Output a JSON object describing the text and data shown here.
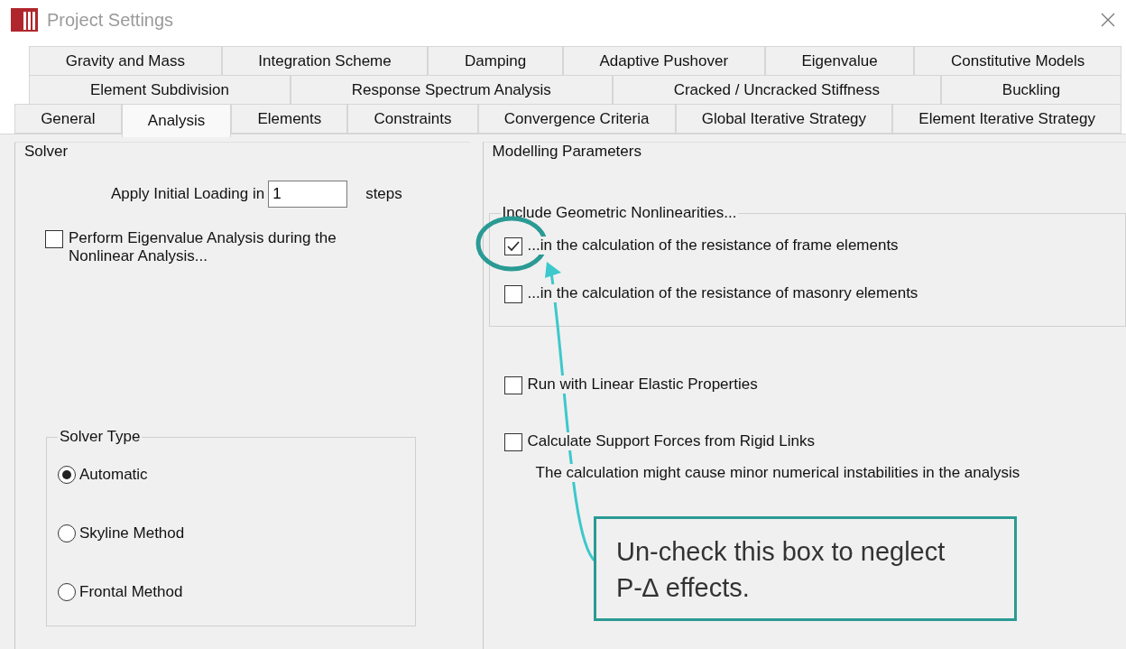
{
  "window": {
    "title": "Project Settings"
  },
  "tab_rows": [
    [
      {
        "label": "Gravity and Mass",
        "selected": false
      },
      {
        "label": "Integration Scheme",
        "selected": false
      },
      {
        "label": "Damping",
        "selected": false
      },
      {
        "label": "Adaptive Pushover",
        "selected": false
      },
      {
        "label": "Eigenvalue",
        "selected": false
      },
      {
        "label": "Constitutive Models",
        "selected": false
      }
    ],
    [
      {
        "label": "Element Subdivision",
        "selected": false
      },
      {
        "label": "Response Spectrum Analysis",
        "selected": false
      },
      {
        "label": "Cracked / Uncracked Stiffness",
        "selected": false
      },
      {
        "label": "Buckling",
        "selected": false
      }
    ],
    [
      {
        "label": "General",
        "selected": false
      },
      {
        "label": "Analysis",
        "selected": true
      },
      {
        "label": "Elements",
        "selected": false
      },
      {
        "label": "Constraints",
        "selected": false
      },
      {
        "label": "Convergence Criteria",
        "selected": false
      },
      {
        "label": "Global Iterative Strategy",
        "selected": false
      },
      {
        "label": "Element Iterative Strategy",
        "selected": false
      }
    ]
  ],
  "solver": {
    "title": "Solver",
    "initial_loading": {
      "label": "Apply Initial Loading in",
      "value": "1",
      "unit": "steps"
    },
    "eigen": {
      "label": "Perform Eigenvalue Analysis during the Nonlinear Analysis...",
      "checked": false
    },
    "solver_type": {
      "title": "Solver Type",
      "options": [
        {
          "label": "Automatic",
          "selected": true
        },
        {
          "label": "Skyline Method",
          "selected": false
        },
        {
          "label": "Frontal Method",
          "selected": false
        }
      ]
    }
  },
  "modelling": {
    "title": "Modelling Parameters",
    "geometric": {
      "title": "Include Geometric Nonlinearities...",
      "options": [
        {
          "label": "...in the calculation of the resistance of frame elements",
          "checked": true
        },
        {
          "label": "...in the calculation of the resistance of masonry elements",
          "checked": false
        }
      ]
    },
    "options": [
      {
        "label": "Run with Linear Elastic Properties",
        "checked": false
      },
      {
        "label": "Calculate Support Forces from Rigid Links",
        "checked": false,
        "note": "The calculation might cause minor numerical instabilities in the analysis"
      }
    ]
  },
  "annotation": {
    "text": "Un-check this box to neglect P-∆ effects."
  }
}
